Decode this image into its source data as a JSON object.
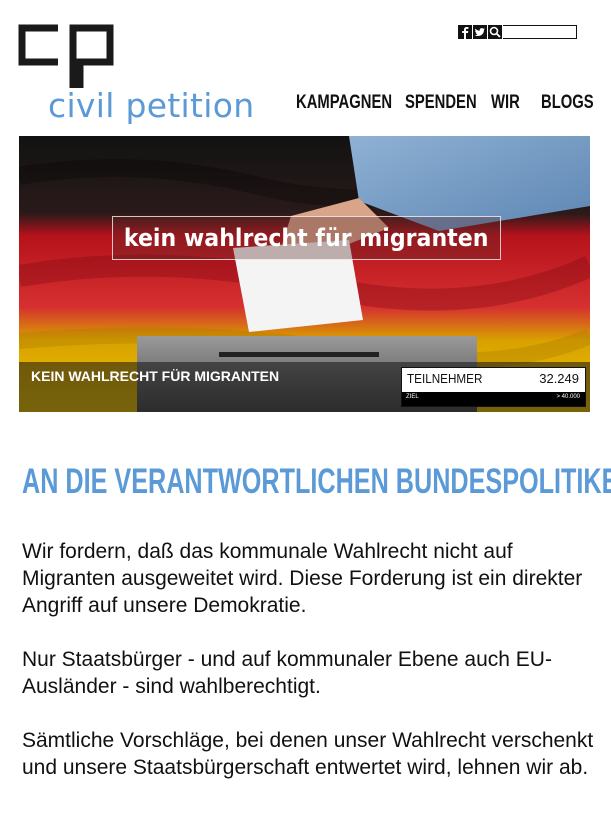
{
  "brand": {
    "name": "civil petition"
  },
  "social": {
    "icons": [
      "facebook-icon",
      "twitter-icon",
      "search-icon"
    ],
    "search_placeholder": ""
  },
  "nav": {
    "items": [
      "KAMPAGNEN",
      "SPENDEN",
      "WIR",
      "BLOGS"
    ]
  },
  "hero": {
    "caption": "kein wahlrecht für migranten",
    "title": "KEIN WAHLRECHT FÜR MIGRANTEN",
    "counter": {
      "label": "TEILNEHMER",
      "value": "32.249",
      "goal_label": "ZIEL",
      "goal_value": "> 40.000"
    }
  },
  "content": {
    "headline": "AN DIE VERANTWORTLICHEN BUNDESPOLITIKER",
    "paragraphs": [
      "Wir fordern, daß das kommunale Wahlrecht nicht auf Migranten ausgeweitet wird. Diese Forderung ist ein direkter Angriff auf unsere Demokratie.",
      "Nur Staatsbürger - und auf kommunaler Ebene auch EU-Ausländer - sind wahlberechtigt.",
      "Sämtliche Vorschläge, bei denen unser Wahlrecht verschenkt und unsere Staatsbürgerschaft entwertet wird, lehnen wir ab."
    ]
  },
  "colors": {
    "accent": "#5b9ad6",
    "flag_black": "#1a1a1a",
    "flag_red": "#d0202a",
    "flag_gold": "#f2c500"
  }
}
